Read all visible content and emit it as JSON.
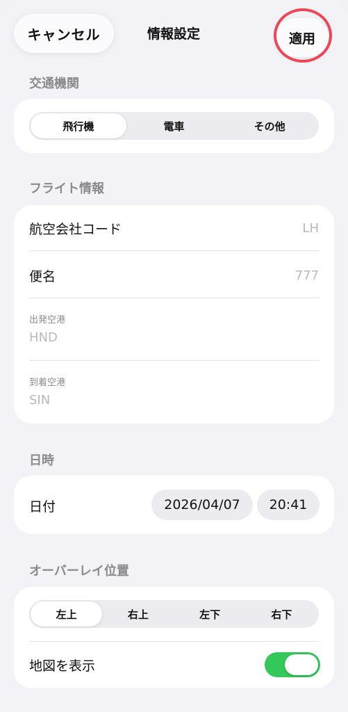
{
  "header": {
    "cancel_label": "キャンセル",
    "title": "情報設定",
    "apply_label": "適用"
  },
  "transport": {
    "section_title": "交通機関",
    "options": [
      "飛行機",
      "電車",
      "その他"
    ],
    "selected": "飛行機"
  },
  "flight": {
    "section_title": "フライト情報",
    "airline_label": "航空会社コード",
    "airline_placeholder": "LH",
    "flight_label": "便名",
    "flight_placeholder": "777",
    "departure_label": "出発空港",
    "departure_placeholder": "HND",
    "arrival_label": "到着空港",
    "arrival_placeholder": "SIN"
  },
  "datetime": {
    "section_title": "日時",
    "date_label": "日付",
    "date_value": "2026/04/07",
    "time_value": "20:41"
  },
  "overlay": {
    "section_title": "オーバーレイ位置",
    "positions": [
      "左上",
      "右上",
      "左下",
      "右下"
    ],
    "selected": "左上",
    "map_label": "地図を表示",
    "map_enabled": true
  },
  "colors": {
    "accent_toggle": "#34c759",
    "highlight_ring": "#ef4656"
  }
}
